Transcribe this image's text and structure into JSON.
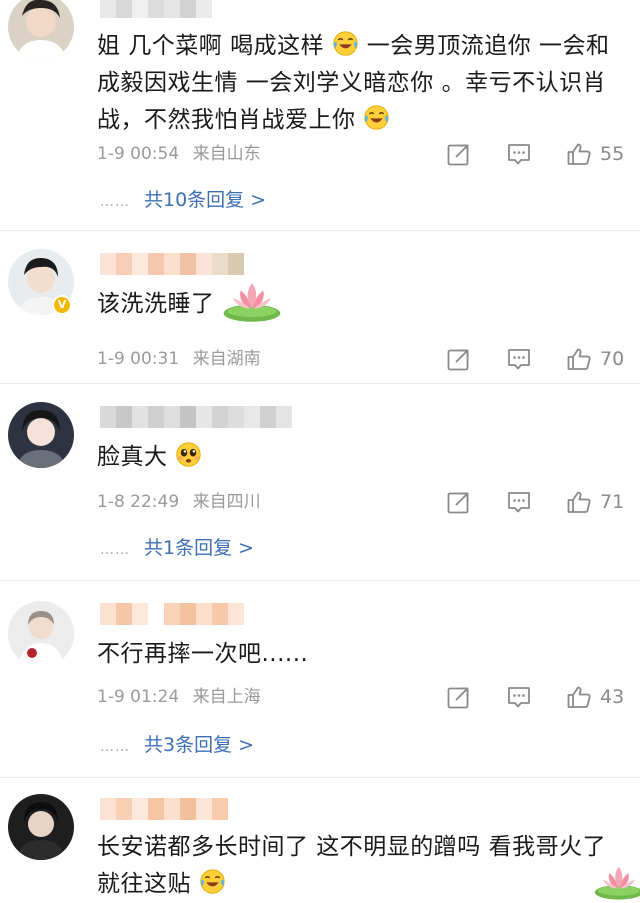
{
  "comments": [
    {
      "text_parts": [
        "姐 几个菜啊 喝成这样",
        "一会男顶流追你 一会和成毅因戏生情 一会刘学义暗恋你 。幸亏不认识肖战，不然我怕肖战爱上你"
      ],
      "time": "1-9 00:54",
      "location": "来自山东",
      "likes": "55",
      "replies_label": "共10条回复 >",
      "dots": "……"
    },
    {
      "text": "该洗洗睡了",
      "time": "1-9 00:31",
      "location": "来自湖南",
      "likes": "70"
    },
    {
      "text": "脸真大",
      "time": "1-8 22:49",
      "location": "来自四川",
      "likes": "71",
      "replies_label": "共1条回复 >",
      "dots": "……"
    },
    {
      "text": "不行再摔一次吧......",
      "time": "1-9 01:24",
      "location": "来自上海",
      "likes": "43",
      "replies_label": "共3条回复 >",
      "dots": "……"
    },
    {
      "text_parts": [
        "长安诺都多长时间了 这不明显的蹭吗 看我哥火了 就往这贴"
      ]
    }
  ],
  "icons": {
    "share": "share-icon",
    "comment": "comment-icon",
    "like": "thumbs-up-icon",
    "emoji_laugh": "laugh-cry-emoji",
    "emoji_cry": "pleading-emoji",
    "lotus": "lotus-sticker"
  },
  "colors": {
    "link": "#3d6fb5",
    "meta": "#9a9a9a",
    "text": "#1a1a1a",
    "verified": "#f5b800"
  }
}
